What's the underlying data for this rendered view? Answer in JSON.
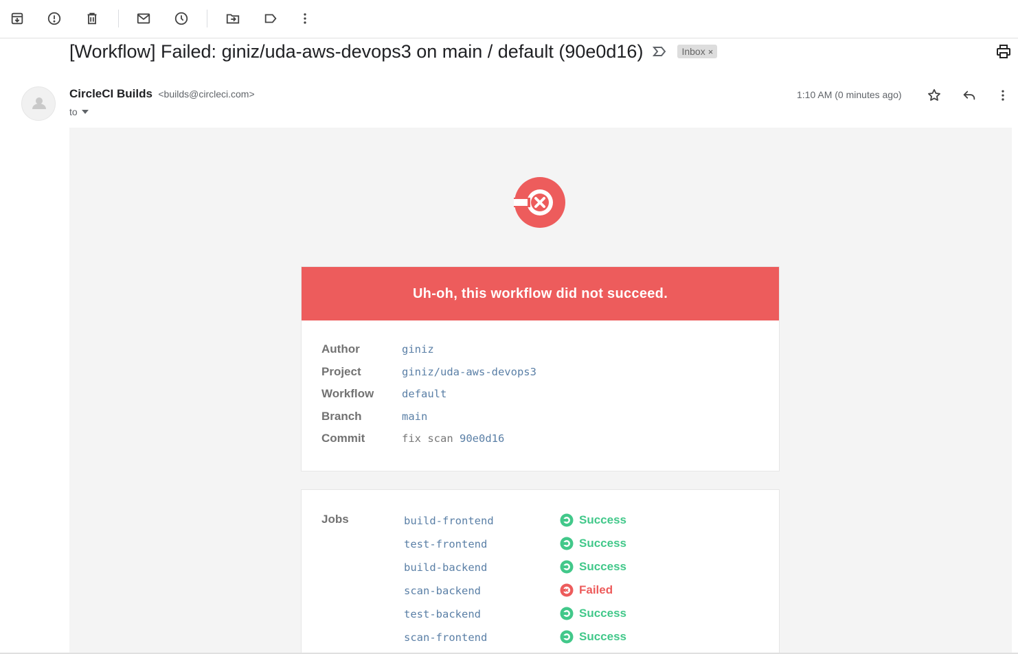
{
  "subject": {
    "text": "[Workflow] Failed: giniz/uda-aws-devops3 on main / default (90e0d16)",
    "label_chip": "Inbox",
    "chip_close": "×"
  },
  "toolbar": {
    "icons": [
      "archive-icon",
      "report-spam-icon",
      "delete-icon",
      "mark-unread-icon",
      "snooze-icon",
      "move-to-icon",
      "label-icon",
      "more-icon"
    ]
  },
  "message": {
    "sender_name": "CircleCI Builds",
    "sender_email": "<builds@circleci.com>",
    "to_label": "to",
    "time": "1:10 AM (0 minutes ago)"
  },
  "body": {
    "banner": "Uh-oh, this workflow did not succeed.",
    "details": [
      {
        "label": "Author",
        "value": "giniz",
        "plain_prefix": ""
      },
      {
        "label": "Project",
        "value": "giniz/uda-aws-devops3",
        "plain_prefix": ""
      },
      {
        "label": "Workflow",
        "value": "default",
        "plain_prefix": ""
      },
      {
        "label": "Branch",
        "value": "main",
        "plain_prefix": ""
      },
      {
        "label": "Commit",
        "value": "90e0d16",
        "plain_prefix": "fix scan "
      }
    ],
    "jobs_label": "Jobs",
    "jobs": [
      {
        "name": "build-frontend",
        "status": "Success"
      },
      {
        "name": "test-frontend",
        "status": "Success"
      },
      {
        "name": "build-backend",
        "status": "Success"
      },
      {
        "name": "scan-backend",
        "status": "Failed"
      },
      {
        "name": "test-backend",
        "status": "Success"
      },
      {
        "name": "scan-frontend",
        "status": "Success"
      }
    ]
  },
  "colors": {
    "fail_red": "#ed5c5c",
    "success_green": "#42c88a",
    "link_blue": "#5a7fa6",
    "body_bg": "#f4f4f4"
  }
}
